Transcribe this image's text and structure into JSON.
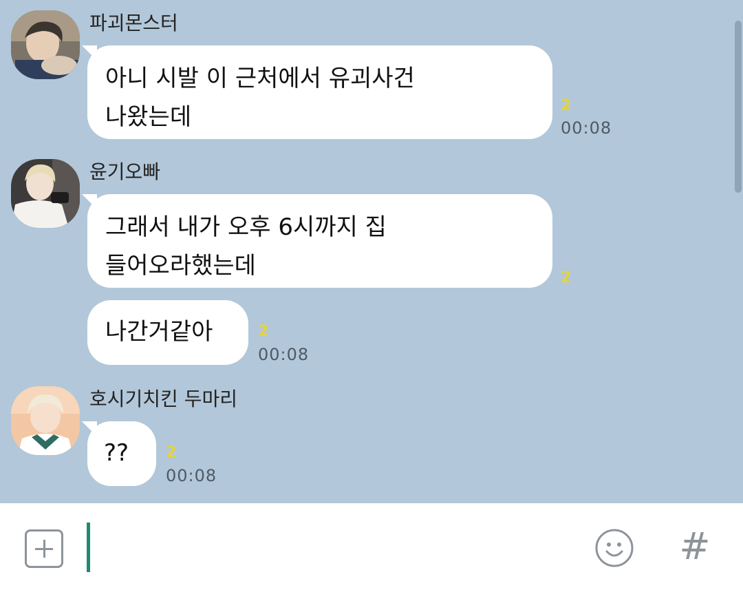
{
  "messages": [
    {
      "sender": "파괴몬스터",
      "lines": [
        "아니 시발 이 근처에서 유괴사건",
        "나왔는데"
      ],
      "unread": "2",
      "time": "00:08"
    },
    {
      "sender": "윤기오빠",
      "lines": [
        "그래서 내가 오후 6시까지 집",
        "들어오라했는데"
      ],
      "unread": "2",
      "time": ""
    },
    {
      "sender": "",
      "lines": [
        "나간거같아"
      ],
      "unread": "2",
      "time": "00:08"
    },
    {
      "sender": "호시기치킨 두마리",
      "lines": [
        "??"
      ],
      "unread": "2",
      "time": "00:08"
    }
  ],
  "input": {
    "value": "",
    "placeholder": ""
  },
  "icons": {
    "attach": "plus-square-icon",
    "emoticon": "smiley-icon",
    "hashtag": "hashtag-icon"
  },
  "colors": {
    "chat_background": "#b2c7d9",
    "bubble": "#ffffff",
    "unread_count": "#e3d43c",
    "cursor": "#1e8a74"
  },
  "hashtag_symbol": "#"
}
